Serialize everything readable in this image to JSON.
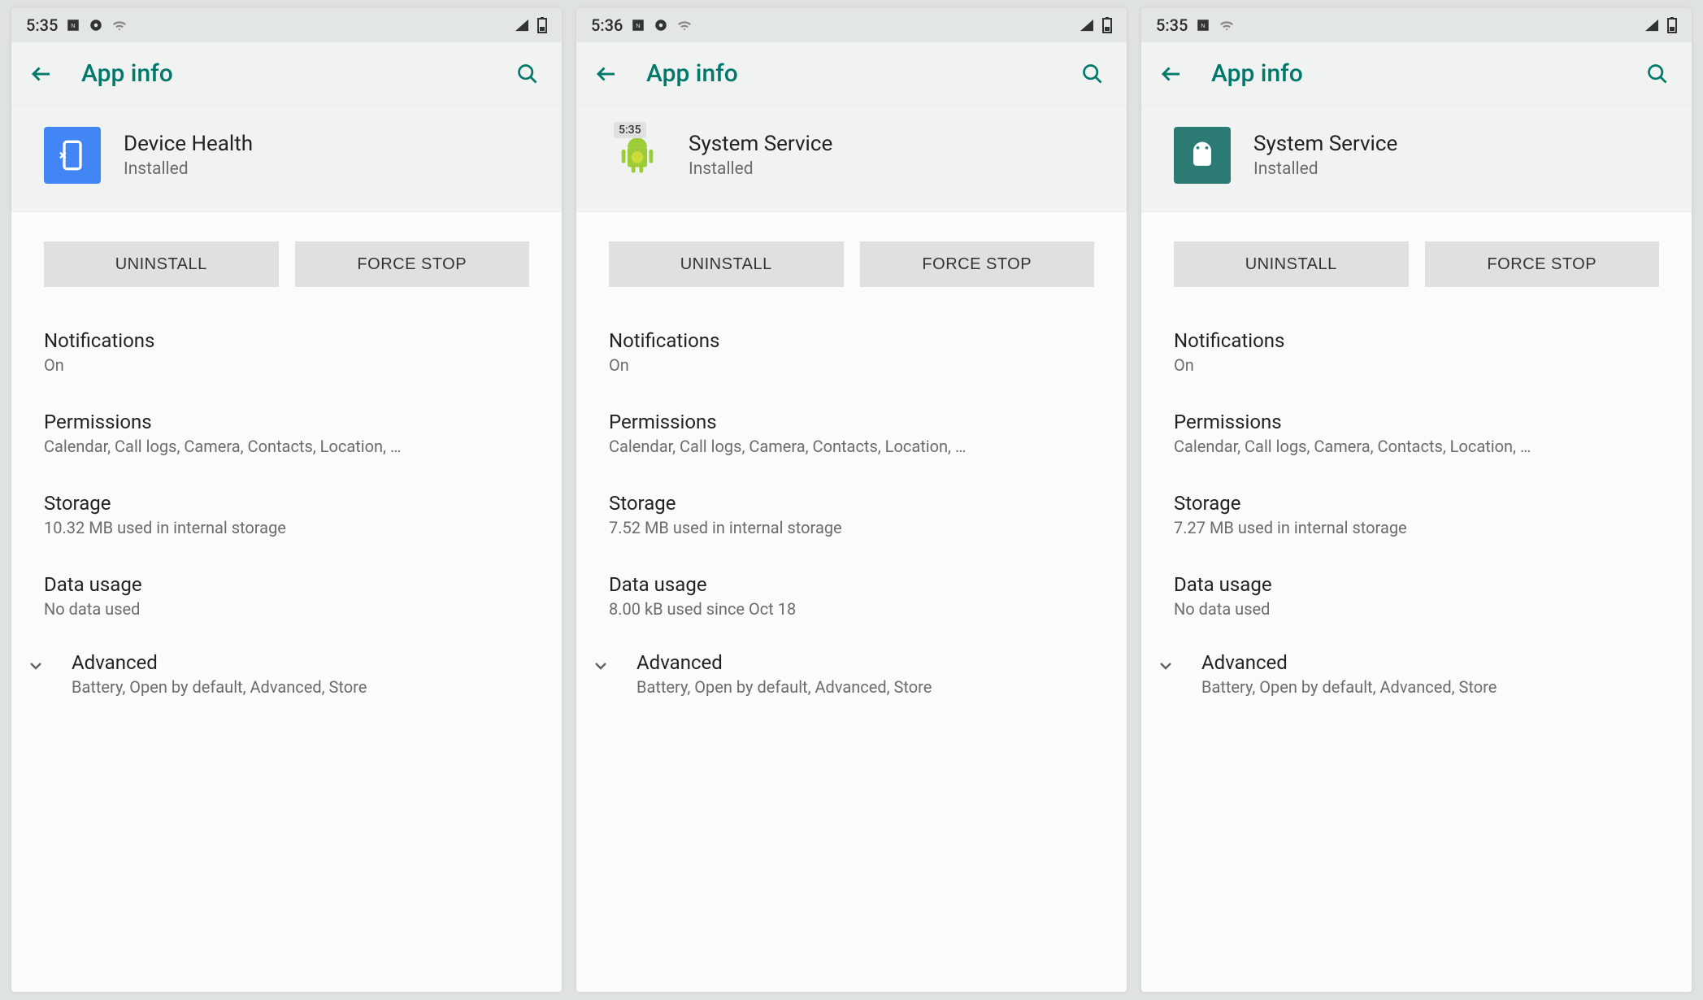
{
  "screens": [
    {
      "statusbar": {
        "time": "5:35"
      },
      "appbar": {
        "title": "App info"
      },
      "app": {
        "name": "Device Health",
        "status": "Installed",
        "iconBadge": ""
      },
      "buttons": {
        "uninstall": "UNINSTALL",
        "forceStop": "FORCE STOP"
      },
      "items": {
        "notifications": {
          "title": "Notifications",
          "sub": "On"
        },
        "permissions": {
          "title": "Permissions",
          "sub": "Calendar, Call logs, Camera, Contacts, Location, …"
        },
        "storage": {
          "title": "Storage",
          "sub": "10.32 MB used in internal storage"
        },
        "dataUsage": {
          "title": "Data usage",
          "sub": "No data used"
        },
        "advanced": {
          "title": "Advanced",
          "sub": "Battery, Open by default, Advanced, Store"
        }
      }
    },
    {
      "statusbar": {
        "time": "5:36"
      },
      "appbar": {
        "title": "App info"
      },
      "app": {
        "name": "System Service",
        "status": "Installed",
        "iconBadge": "5:35"
      },
      "buttons": {
        "uninstall": "UNINSTALL",
        "forceStop": "FORCE STOP"
      },
      "items": {
        "notifications": {
          "title": "Notifications",
          "sub": "On"
        },
        "permissions": {
          "title": "Permissions",
          "sub": "Calendar, Call logs, Camera, Contacts, Location, …"
        },
        "storage": {
          "title": "Storage",
          "sub": "7.52 MB used in internal storage"
        },
        "dataUsage": {
          "title": "Data usage",
          "sub": "8.00 kB used since Oct 18"
        },
        "advanced": {
          "title": "Advanced",
          "sub": "Battery, Open by default, Advanced, Store"
        }
      }
    },
    {
      "statusbar": {
        "time": "5:35"
      },
      "appbar": {
        "title": "App info"
      },
      "app": {
        "name": "System Service",
        "status": "Installed",
        "iconBadge": ""
      },
      "buttons": {
        "uninstall": "UNINSTALL",
        "forceStop": "FORCE STOP"
      },
      "items": {
        "notifications": {
          "title": "Notifications",
          "sub": "On"
        },
        "permissions": {
          "title": "Permissions",
          "sub": "Calendar, Call logs, Camera, Contacts, Location, …"
        },
        "storage": {
          "title": "Storage",
          "sub": "7.27 MB used in internal storage"
        },
        "dataUsage": {
          "title": "Data usage",
          "sub": "No data used"
        },
        "advanced": {
          "title": "Advanced",
          "sub": "Battery, Open by default, Advanced, Store"
        }
      }
    }
  ]
}
